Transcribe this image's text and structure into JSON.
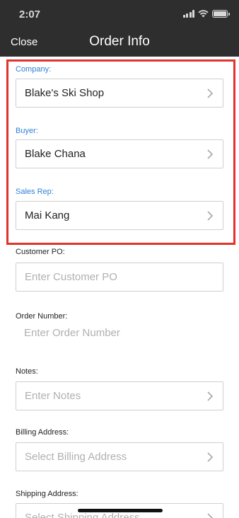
{
  "status_bar": {
    "time": "2:07"
  },
  "header": {
    "close_label": "Close",
    "title": "Order Info"
  },
  "fields": {
    "company": {
      "label": "Company:",
      "value": "Blake's Ski Shop"
    },
    "buyer": {
      "label": "Buyer:",
      "value": "Blake Chana"
    },
    "sales_rep": {
      "label": "Sales Rep:",
      "value": "Mai Kang"
    },
    "customer_po": {
      "label": "Customer PO:",
      "placeholder": "Enter Customer PO"
    },
    "order_number": {
      "label": "Order Number:",
      "placeholder": "Enter Order Number"
    },
    "notes": {
      "label": "Notes:",
      "placeholder": "Enter Notes"
    },
    "billing_address": {
      "label": "Billing Address:",
      "placeholder": "Select Billing Address"
    },
    "shipping_address": {
      "label": "Shipping Address:",
      "placeholder": "Select Shipping Address"
    }
  },
  "colors": {
    "header_bg": "#2e2e2e",
    "accent_blue": "#2f80d6",
    "highlight_red": "#e1332b"
  }
}
